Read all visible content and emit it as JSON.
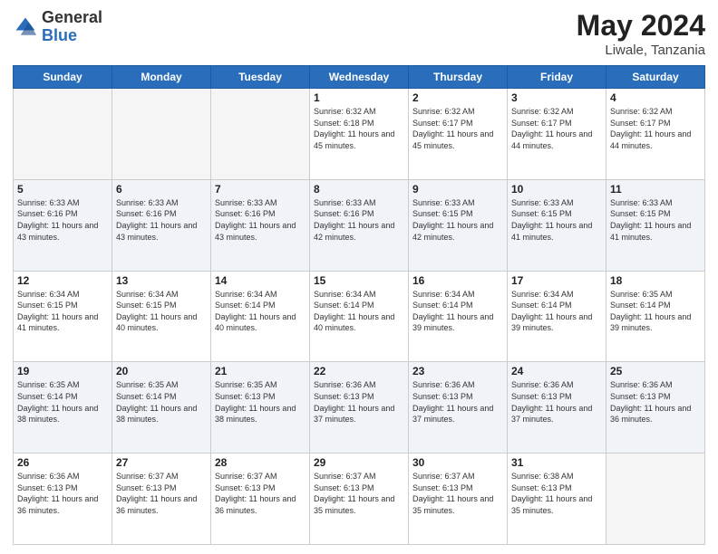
{
  "header": {
    "logo_general": "General",
    "logo_blue": "Blue",
    "title": "May 2024",
    "location": "Liwale, Tanzania"
  },
  "days_of_week": [
    "Sunday",
    "Monday",
    "Tuesday",
    "Wednesday",
    "Thursday",
    "Friday",
    "Saturday"
  ],
  "weeks": [
    [
      {
        "day": "",
        "info": ""
      },
      {
        "day": "",
        "info": ""
      },
      {
        "day": "",
        "info": ""
      },
      {
        "day": "1",
        "info": "Sunrise: 6:32 AM\nSunset: 6:18 PM\nDaylight: 11 hours and 45 minutes."
      },
      {
        "day": "2",
        "info": "Sunrise: 6:32 AM\nSunset: 6:17 PM\nDaylight: 11 hours and 45 minutes."
      },
      {
        "day": "3",
        "info": "Sunrise: 6:32 AM\nSunset: 6:17 PM\nDaylight: 11 hours and 44 minutes."
      },
      {
        "day": "4",
        "info": "Sunrise: 6:32 AM\nSunset: 6:17 PM\nDaylight: 11 hours and 44 minutes."
      }
    ],
    [
      {
        "day": "5",
        "info": "Sunrise: 6:33 AM\nSunset: 6:16 PM\nDaylight: 11 hours and 43 minutes."
      },
      {
        "day": "6",
        "info": "Sunrise: 6:33 AM\nSunset: 6:16 PM\nDaylight: 11 hours and 43 minutes."
      },
      {
        "day": "7",
        "info": "Sunrise: 6:33 AM\nSunset: 6:16 PM\nDaylight: 11 hours and 43 minutes."
      },
      {
        "day": "8",
        "info": "Sunrise: 6:33 AM\nSunset: 6:16 PM\nDaylight: 11 hours and 42 minutes."
      },
      {
        "day": "9",
        "info": "Sunrise: 6:33 AM\nSunset: 6:15 PM\nDaylight: 11 hours and 42 minutes."
      },
      {
        "day": "10",
        "info": "Sunrise: 6:33 AM\nSunset: 6:15 PM\nDaylight: 11 hours and 41 minutes."
      },
      {
        "day": "11",
        "info": "Sunrise: 6:33 AM\nSunset: 6:15 PM\nDaylight: 11 hours and 41 minutes."
      }
    ],
    [
      {
        "day": "12",
        "info": "Sunrise: 6:34 AM\nSunset: 6:15 PM\nDaylight: 11 hours and 41 minutes."
      },
      {
        "day": "13",
        "info": "Sunrise: 6:34 AM\nSunset: 6:15 PM\nDaylight: 11 hours and 40 minutes."
      },
      {
        "day": "14",
        "info": "Sunrise: 6:34 AM\nSunset: 6:14 PM\nDaylight: 11 hours and 40 minutes."
      },
      {
        "day": "15",
        "info": "Sunrise: 6:34 AM\nSunset: 6:14 PM\nDaylight: 11 hours and 40 minutes."
      },
      {
        "day": "16",
        "info": "Sunrise: 6:34 AM\nSunset: 6:14 PM\nDaylight: 11 hours and 39 minutes."
      },
      {
        "day": "17",
        "info": "Sunrise: 6:34 AM\nSunset: 6:14 PM\nDaylight: 11 hours and 39 minutes."
      },
      {
        "day": "18",
        "info": "Sunrise: 6:35 AM\nSunset: 6:14 PM\nDaylight: 11 hours and 39 minutes."
      }
    ],
    [
      {
        "day": "19",
        "info": "Sunrise: 6:35 AM\nSunset: 6:14 PM\nDaylight: 11 hours and 38 minutes."
      },
      {
        "day": "20",
        "info": "Sunrise: 6:35 AM\nSunset: 6:14 PM\nDaylight: 11 hours and 38 minutes."
      },
      {
        "day": "21",
        "info": "Sunrise: 6:35 AM\nSunset: 6:13 PM\nDaylight: 11 hours and 38 minutes."
      },
      {
        "day": "22",
        "info": "Sunrise: 6:36 AM\nSunset: 6:13 PM\nDaylight: 11 hours and 37 minutes."
      },
      {
        "day": "23",
        "info": "Sunrise: 6:36 AM\nSunset: 6:13 PM\nDaylight: 11 hours and 37 minutes."
      },
      {
        "day": "24",
        "info": "Sunrise: 6:36 AM\nSunset: 6:13 PM\nDaylight: 11 hours and 37 minutes."
      },
      {
        "day": "25",
        "info": "Sunrise: 6:36 AM\nSunset: 6:13 PM\nDaylight: 11 hours and 36 minutes."
      }
    ],
    [
      {
        "day": "26",
        "info": "Sunrise: 6:36 AM\nSunset: 6:13 PM\nDaylight: 11 hours and 36 minutes."
      },
      {
        "day": "27",
        "info": "Sunrise: 6:37 AM\nSunset: 6:13 PM\nDaylight: 11 hours and 36 minutes."
      },
      {
        "day": "28",
        "info": "Sunrise: 6:37 AM\nSunset: 6:13 PM\nDaylight: 11 hours and 36 minutes."
      },
      {
        "day": "29",
        "info": "Sunrise: 6:37 AM\nSunset: 6:13 PM\nDaylight: 11 hours and 35 minutes."
      },
      {
        "day": "30",
        "info": "Sunrise: 6:37 AM\nSunset: 6:13 PM\nDaylight: 11 hours and 35 minutes."
      },
      {
        "day": "31",
        "info": "Sunrise: 6:38 AM\nSunset: 6:13 PM\nDaylight: 11 hours and 35 minutes."
      },
      {
        "day": "",
        "info": ""
      }
    ]
  ]
}
